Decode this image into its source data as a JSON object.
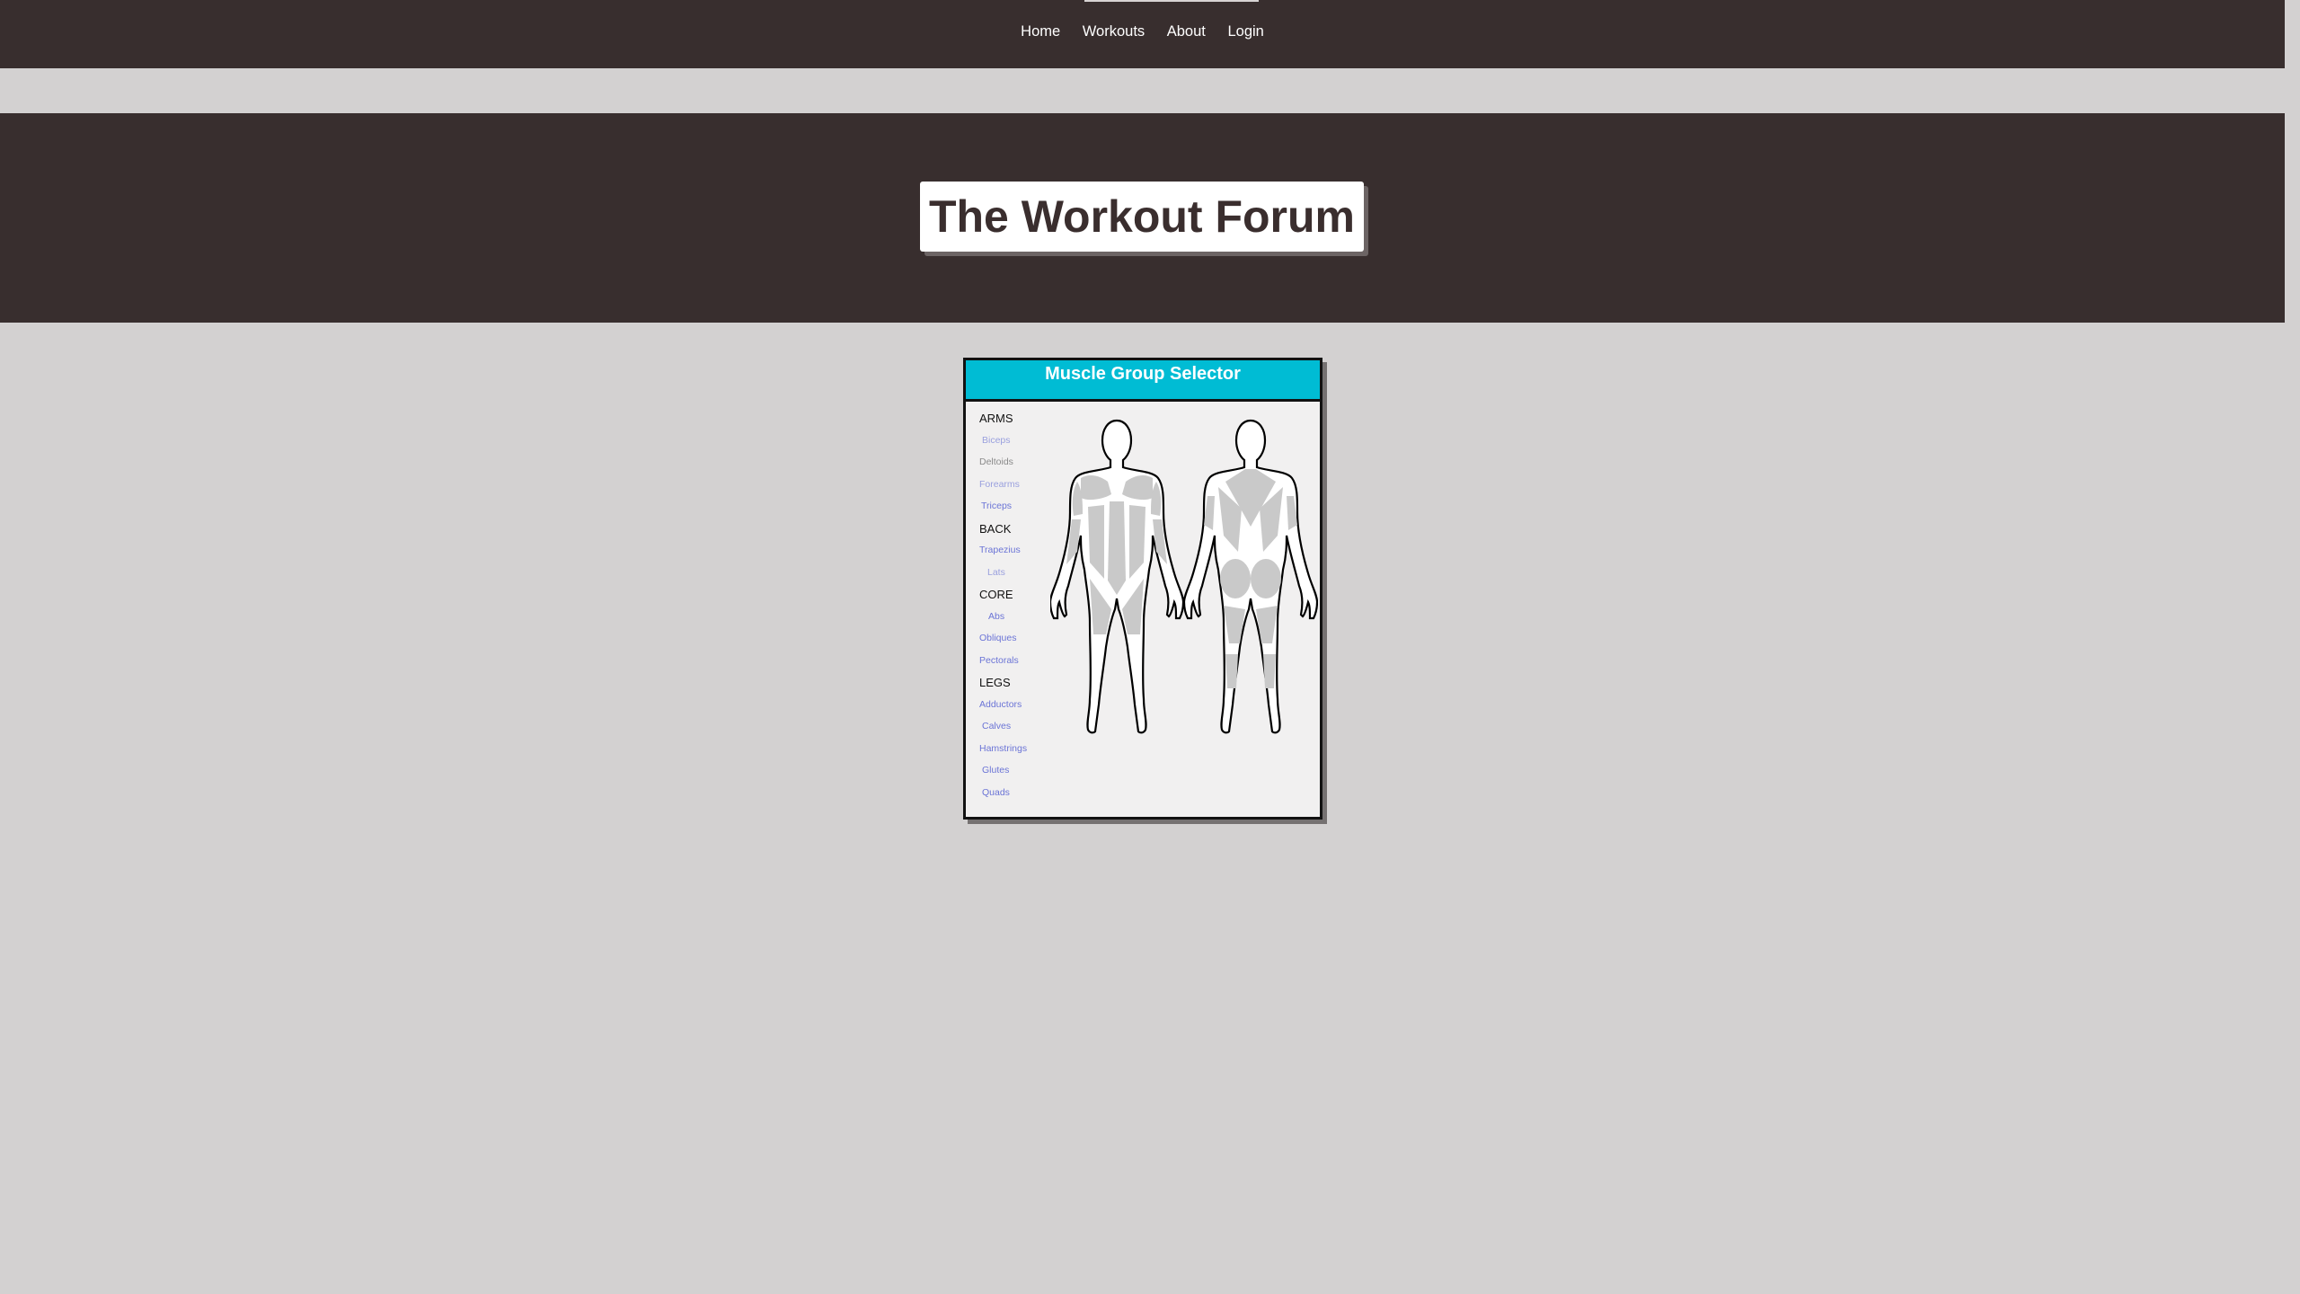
{
  "nav": {
    "items": [
      {
        "label": "Home"
      },
      {
        "label": "Workouts"
      },
      {
        "label": "About"
      },
      {
        "label": "Login"
      }
    ]
  },
  "hero": {
    "title": "The Workout Forum"
  },
  "selector": {
    "title": "Muscle Group Selector",
    "groups": [
      {
        "label": "ARMS",
        "items": [
          "Biceps",
          "Deltoids",
          "Forearms",
          "Triceps"
        ]
      },
      {
        "label": "BACK",
        "items": [
          "Trapezius",
          "Lats"
        ]
      },
      {
        "label": "CORE",
        "items": [
          "Abs",
          "Obliques",
          "Pectorals"
        ]
      },
      {
        "label": "LEGS",
        "items": [
          "Adductors",
          "Calves",
          "Hamstrings",
          "Glutes",
          "Quads"
        ]
      }
    ]
  },
  "colors": {
    "nav_bg": "#382e2e",
    "page_bg": "#d3d1d1",
    "selector_header": "#00bcd4",
    "link": "#6b74d6"
  }
}
